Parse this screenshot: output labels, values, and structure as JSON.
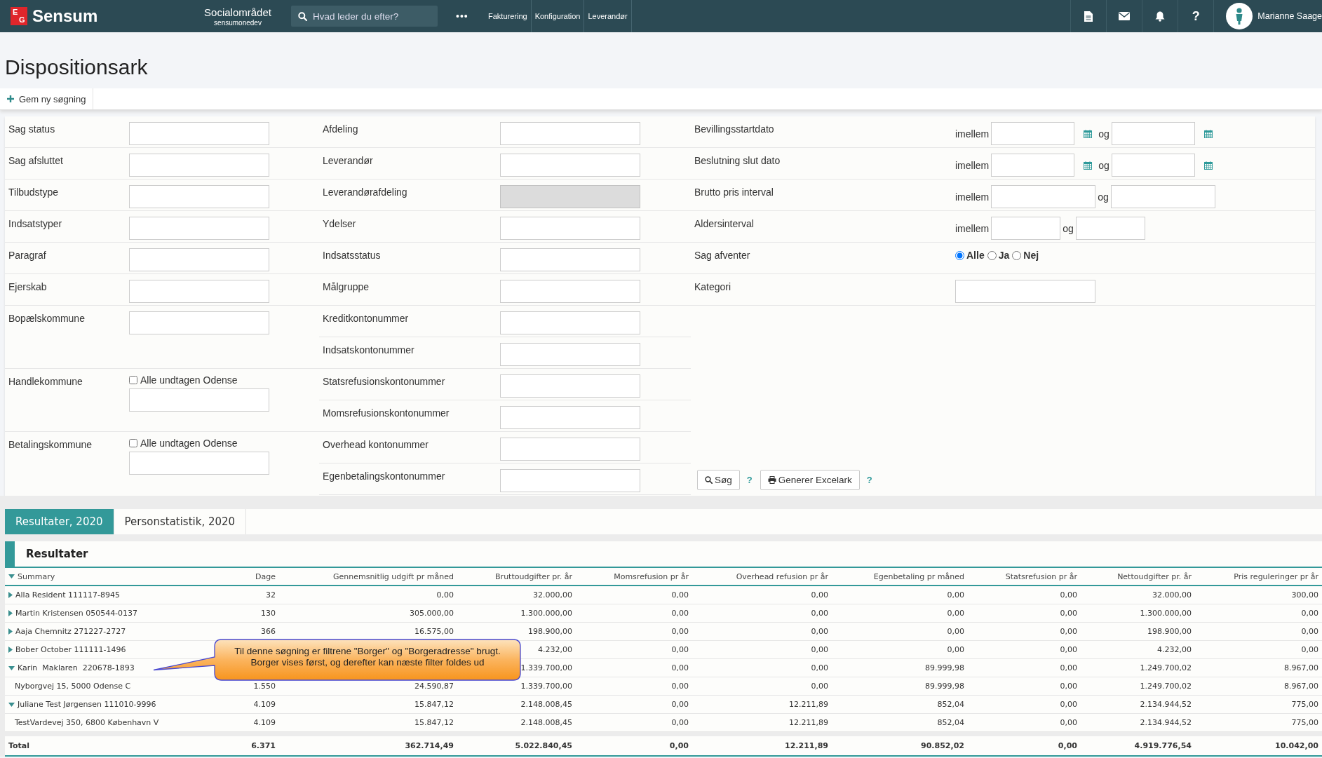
{
  "topbar": {
    "logo": {
      "mark": [
        "E",
        "G"
      ],
      "name": "Sensum"
    },
    "area": {
      "title": "Socialområdet",
      "subtitle": "sensumonedev"
    },
    "search": {
      "placeholder": "Hvad leder du efter?"
    },
    "more": "•••",
    "menu": [
      "Fakturering",
      "Konfiguration",
      "Leverandør"
    ],
    "help": "?",
    "user": {
      "name": "Marianne Saage"
    }
  },
  "page": {
    "title": "Dispositionsark",
    "toolbar": [
      {
        "label": "Gem ny søgning"
      }
    ]
  },
  "form": {
    "columns": [
      [
        {
          "label": "Sag status",
          "kind": "text",
          "disabled": false
        },
        {
          "label": "Sag afsluttet",
          "kind": "text",
          "disabled": false
        },
        {
          "label": "Tilbudstype",
          "kind": "text",
          "disabled": false
        },
        {
          "label": "Indsatstyper",
          "kind": "text",
          "disabled": false
        },
        {
          "label": "Paragraf",
          "kind": "text",
          "disabled": false
        },
        {
          "label": "Ejerskab",
          "kind": "text",
          "disabled": false
        },
        {
          "label": "Bopælskommune",
          "kind": "text",
          "disabled": false
        },
        {
          "label": "Handlekommune",
          "kind": "checkbox_text",
          "option": "Alle undtagen Odense",
          "checked": false
        },
        {
          "label": "Betalingskommune",
          "kind": "checkbox_text",
          "option": "Alle undtagen Odense",
          "checked": false
        }
      ],
      [
        {
          "label": "Afdeling",
          "kind": "text",
          "disabled": false
        },
        {
          "label": "Leverandør",
          "kind": "text",
          "disabled": false
        },
        {
          "label": "Leverandørafdeling",
          "kind": "text",
          "disabled": true
        },
        {
          "label": "Ydelser",
          "kind": "text",
          "disabled": false
        },
        {
          "label": "Indsatsstatus",
          "kind": "text",
          "disabled": false
        },
        {
          "label": "Målgruppe",
          "kind": "text",
          "disabled": false
        },
        {
          "label": "Kreditkontonummer",
          "kind": "text",
          "disabled": false
        },
        {
          "label": "Indsatskontonummer",
          "kind": "text",
          "disabled": false
        },
        {
          "label": "Statsrefusionskontonummer",
          "kind": "text",
          "disabled": false
        },
        {
          "label": "Momsrefusionskontonummer",
          "kind": "text",
          "disabled": false
        },
        {
          "label": "Overhead kontonummer",
          "kind": "text",
          "disabled": false
        },
        {
          "label": "Egenbetalingskontonummer",
          "kind": "text",
          "disabled": false
        }
      ],
      [
        {
          "label": "Bevillingsstartdato",
          "kind": "date_range",
          "from_label": "imellem",
          "to_label": "og"
        },
        {
          "label": "Beslutning slut dato",
          "kind": "date_range",
          "from_label": "imellem",
          "to_label": "og"
        },
        {
          "label": "Brutto pris interval",
          "kind": "amount_range",
          "from_label": "imellem",
          "to_label": "og"
        },
        {
          "label": "Aldersinterval",
          "kind": "number_range",
          "from_label": "imellem",
          "to_label": "og"
        },
        {
          "label": "Sag afventer",
          "kind": "radio",
          "options": [
            {
              "label": "Alle",
              "selected": true
            },
            {
              "label": "Ja",
              "selected": false
            },
            {
              "label": "Nej",
              "selected": false
            }
          ]
        },
        {
          "label": "Kategori",
          "kind": "text",
          "disabled": false
        }
      ]
    ],
    "actions": [
      {
        "kind": "search",
        "label": "Søg"
      },
      {
        "kind": "help",
        "label": "?"
      },
      {
        "kind": "export",
        "label": "Generer Excelark"
      },
      {
        "kind": "help",
        "label": "?"
      }
    ]
  },
  "tabs": [
    {
      "label": "Resultater, 2020",
      "selected": true
    },
    {
      "label": "Personstatistik, 2020",
      "selected": false
    }
  ],
  "results": {
    "title": "Resultater",
    "summary_expanded": true,
    "columns": [
      "Summary",
      "Dage",
      "Gennemsnitlig udgift pr måned",
      "Bruttoudgifter pr. år",
      "Momsrefusion pr år",
      "Overhead refusion pr år",
      "Egenbetaling pr måned",
      "Statsrefusion pr år",
      "Nettoudgifter pr. år",
      "Pris reguleringer pr år"
    ],
    "rows": [
      {
        "kind": "group",
        "expanded": false,
        "label": "Alla Resident 111117-8945",
        "values": [
          "32",
          "0,00",
          "32.000,00",
          "0,00",
          "0,00",
          "0,00",
          "0,00",
          "32.000,00",
          "300,00"
        ]
      },
      {
        "kind": "group",
        "expanded": false,
        "label": "Martin Kristensen 050544-0137",
        "values": [
          "130",
          "305.000,00",
          "1.300.000,00",
          "0,00",
          "0,00",
          "0,00",
          "0,00",
          "1.300.000,00",
          "0,00"
        ]
      },
      {
        "kind": "group",
        "expanded": false,
        "label": "Aaja Chemnitz 271227-2727",
        "values": [
          "366",
          "16.575,00",
          "198.900,00",
          "0,00",
          "0,00",
          "0,00",
          "0,00",
          "198.900,00",
          "0,00"
        ]
      },
      {
        "kind": "group",
        "expanded": false,
        "label": "Bober October 111111-1496",
        "values": [
          "4.232,00",
          "0,00",
          "0,00",
          "0,00",
          "0,00",
          "4.232,00",
          "0,00"
        ]
      },
      {
        "kind": "group",
        "expanded": true,
        "label": "Karin  Maklaren  220678-1893",
        "values": [
          "1.339.700,00",
          "0,00",
          "0,00",
          "89.999,98",
          "0,00",
          "1.249.700,02",
          "8.967,00"
        ]
      },
      {
        "kind": "detail",
        "label": "Nyborgvej 15, 5000 Odense C",
        "values": [
          "1.550",
          "24.590,87",
          "1.339.700,00",
          "0,00",
          "0,00",
          "89.999,98",
          "0,00",
          "1.249.700,02",
          "8.967,00"
        ]
      },
      {
        "kind": "group",
        "expanded": true,
        "label": "Juliane Test Jørgensen 111010-9996",
        "values": [
          "4.109",
          "15.847,12",
          "2.148.008,45",
          "0,00",
          "12.211,89",
          "852,04",
          "0,00",
          "2.134.944,52",
          "775,00"
        ]
      },
      {
        "kind": "detail",
        "label": "TestVardevej 350, 6800 København V",
        "values": [
          "4.109",
          "15.847,12",
          "2.148.008,45",
          "0,00",
          "12.211,89",
          "852,04",
          "0,00",
          "2.134.944,52",
          "775,00"
        ]
      }
    ],
    "total": {
      "label": "Total",
      "values": [
        "6.371",
        "362.714,49",
        "5.022.840,45",
        "0,00",
        "12.211,89",
        "90.852,02",
        "0,00",
        "4.919.776,54",
        "10.042,00"
      ]
    }
  },
  "callout": {
    "lines": [
      "Til denne søgning er filtrene \"Borger\" og \"Borgeradresse\" brugt.",
      "Borger vises først, og derefter kan næste filter foldes ud"
    ]
  }
}
